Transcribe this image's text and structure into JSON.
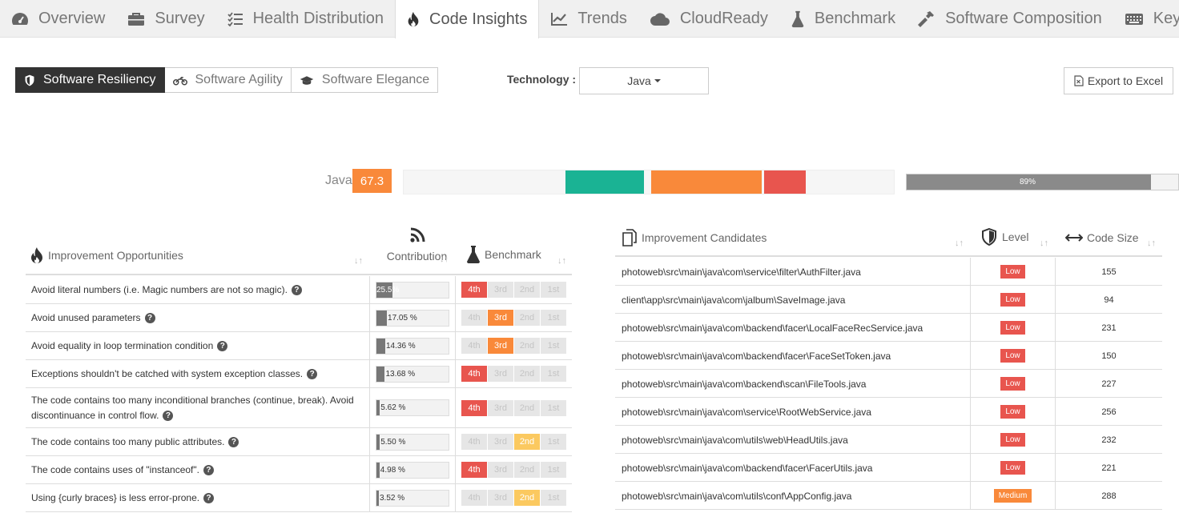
{
  "tabs": [
    {
      "label": "Overview",
      "icon": "dashboard-icon"
    },
    {
      "label": "Survey",
      "icon": "briefcase-icon"
    },
    {
      "label": "Health Distribution",
      "icon": "checklist-icon"
    },
    {
      "label": "Code Insights",
      "icon": "flame-icon",
      "active": true
    },
    {
      "label": "Trends",
      "icon": "line-chart-icon"
    },
    {
      "label": "CloudReady",
      "icon": "cloud-icon"
    },
    {
      "label": "Benchmark",
      "icon": "flask-icon"
    },
    {
      "label": "Software Composition",
      "icon": "hammer-icon"
    },
    {
      "label": "Keywords",
      "icon": "keyboard-icon"
    }
  ],
  "toolbar": {
    "segments": [
      {
        "label": "Software Resiliency",
        "icon": "shield-icon",
        "active": true
      },
      {
        "label": "Software Agility",
        "icon": "motorcycle-icon"
      },
      {
        "label": "Software Elegance",
        "icon": "graduation-cap-icon"
      }
    ],
    "technology_label": "Technology :",
    "technology_value": "Java",
    "export_label": "Export to Excel"
  },
  "score": {
    "label": "Java",
    "value": "67.3",
    "distribution": [
      {
        "color": "#1ab394",
        "start": 0.33,
        "end": 0.49
      },
      {
        "color": "#f9893a",
        "start": 0.505,
        "end": 0.73
      },
      {
        "color": "#e8554e",
        "start": 0.735,
        "end": 0.82
      }
    ],
    "percent_label": "89%",
    "percent_value": 0.89
  },
  "left_table": {
    "headers": {
      "opportunities": "Improvement Opportunities",
      "contribution": "Contribution",
      "benchmark": "Benchmark"
    },
    "rank_labels": [
      "4th",
      "3rd",
      "2nd",
      "1st"
    ],
    "rows": [
      {
        "text": "Avoid literal numbers (i.e. Magic numbers are not so magic).",
        "contribution": "25.5%",
        "value": 0.255,
        "rank": "4th"
      },
      {
        "text": "Avoid unused parameters",
        "contribution": "17.05 %",
        "value": 0.1705,
        "rank": "3rd"
      },
      {
        "text": "Avoid equality in loop termination condition",
        "contribution": "14.36 %",
        "value": 0.1436,
        "rank": "3rd"
      },
      {
        "text": "Exceptions shouldn't be catched with system exception classes.",
        "contribution": "13.68 %",
        "value": 0.1368,
        "rank": "4th"
      },
      {
        "text": "The code contains too many inconditional branches (continue, break). Avoid discontinuance in control flow.",
        "contribution": "5.62 %",
        "value": 0.0562,
        "rank": "4th",
        "tall": true
      },
      {
        "text": "The code contains too many public attributes.",
        "contribution": "5.50 %",
        "value": 0.055,
        "rank": "2nd"
      },
      {
        "text": "The code contains uses of \"instanceof\".",
        "contribution": "4.98 %",
        "value": 0.0498,
        "rank": "4th"
      },
      {
        "text": "Using {curly braces} is less error-prone.",
        "contribution": "3.52 %",
        "value": 0.0352,
        "rank": "2nd"
      }
    ]
  },
  "right_table": {
    "headers": {
      "candidates": "Improvement Candidates",
      "level": "Level",
      "code_size": "Code Size"
    },
    "rows": [
      {
        "file": "photoweb\\src\\main\\java\\com\\service\\filter\\AuthFilter.java",
        "level": "Low",
        "size": "155"
      },
      {
        "file": "client\\app\\src\\main\\java\\com\\jalbum\\SaveImage.java",
        "level": "Low",
        "size": "94"
      },
      {
        "file": "photoweb\\src\\main\\java\\com\\backend\\facer\\LocalFaceRecService.java",
        "level": "Low",
        "size": "231"
      },
      {
        "file": "photoweb\\src\\main\\java\\com\\backend\\facer\\FaceSetToken.java",
        "level": "Low",
        "size": "150"
      },
      {
        "file": "photoweb\\src\\main\\java\\com\\backend\\scan\\FileTools.java",
        "level": "Low",
        "size": "227"
      },
      {
        "file": "photoweb\\src\\main\\java\\com\\service\\RootWebService.java",
        "level": "Low",
        "size": "256"
      },
      {
        "file": "photoweb\\src\\main\\java\\com\\utils\\web\\HeadUtils.java",
        "level": "Low",
        "size": "232"
      },
      {
        "file": "photoweb\\src\\main\\java\\com\\backend\\facer\\FacerUtils.java",
        "level": "Low",
        "size": "221"
      },
      {
        "file": "photoweb\\src\\main\\java\\com\\utils\\conf\\AppConfig.java",
        "level": "Medium",
        "size": "288"
      }
    ]
  }
}
